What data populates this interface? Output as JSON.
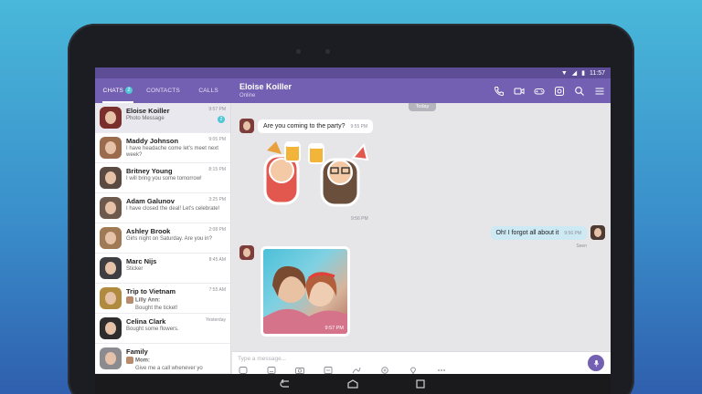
{
  "status_bar": {
    "time": "11:57"
  },
  "tabs": [
    {
      "label": "CHATS",
      "badge": "2"
    },
    {
      "label": "CONTACTS"
    },
    {
      "label": "CALLS"
    }
  ],
  "header": {
    "name": "Eloise Koiller",
    "status": "Online"
  },
  "chats": [
    {
      "name": "Eloise Koiller",
      "preview": "Photo Message",
      "time": "9:57 PM",
      "unread": "2"
    },
    {
      "name": "Maddy Johnson",
      "preview": "I have headache come let's meet next week?",
      "time": "9:05 PM"
    },
    {
      "name": "Britney Young",
      "preview": "I will bring you some tomorrow!",
      "time": "8:15 PM"
    },
    {
      "name": "Adam Galunov",
      "preview": "I have closed the deal! Let's celebrate!",
      "time": "3:25 PM"
    },
    {
      "name": "Ashley Brook",
      "preview": "Girls night on Saturday. Are you in?",
      "time": "2:08 PM"
    },
    {
      "name": "Marc Nijs",
      "preview": "Sticker",
      "time": "8:45 AM"
    },
    {
      "name": "Trip to Vietnam",
      "sender": "Lilly Ann:",
      "preview": "Bought the ticket!",
      "time": "7:55 AM"
    },
    {
      "name": "Celina Clark",
      "preview": "Bought some flowers.",
      "time": "Yesterday"
    },
    {
      "name": "Family",
      "sender": "Mom:",
      "preview": "Give me a call whenever yo"
    }
  ],
  "conversation": {
    "day_label": "Today",
    "msg1": {
      "text": "Are you coming to the party?",
      "time": "9:55 PM"
    },
    "sticker_time": "9:56 PM",
    "msg2": {
      "text": "Oh! I forgot all about it",
      "time": "9:56 PM",
      "status": "Seen"
    },
    "photo_time": "9:57 PM"
  },
  "composer": {
    "placeholder": "Type a message..."
  },
  "colors": {
    "brand": "#7360b2",
    "accent": "#50c6d6",
    "outgoing_bubble": "#cde9f4"
  },
  "icons": {
    "header": [
      "phone-icon",
      "video-icon",
      "gamepad-icon",
      "sticker-icon",
      "search-icon",
      "menu-icon"
    ],
    "composer": [
      "sticker-icon",
      "emoji-icon",
      "camera-icon",
      "gif-icon",
      "doodle-icon",
      "add-contact-icon",
      "location-icon",
      "more-icon",
      "microphone-icon"
    ],
    "nav": [
      "back-icon",
      "home-icon",
      "recents-icon"
    ]
  }
}
